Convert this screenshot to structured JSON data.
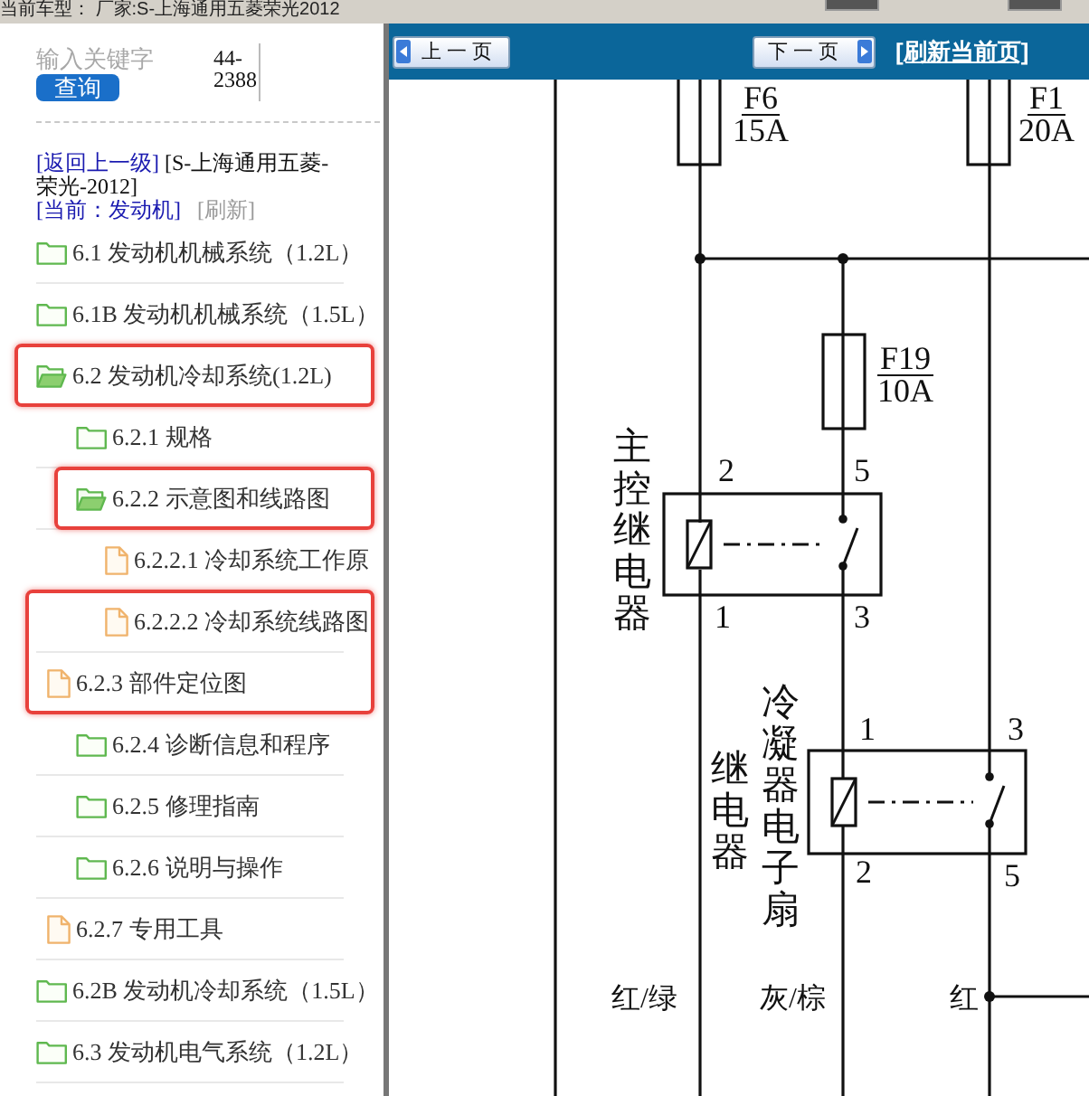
{
  "top_bar": {
    "text": "当前车型： 厂家:S-上海通用五菱荣光2012"
  },
  "sidebar": {
    "search": {
      "placeholder": "输入关键字",
      "side_text": "44-2388",
      "button": "查询"
    },
    "breadcrumb": {
      "back_link": "[返回上一级]",
      "path": "[S-上海通用五菱-荣光-2012]",
      "current": "[当前：发动机]",
      "refresh": "[刷新]"
    },
    "tree": [
      {
        "kind": "folder",
        "label": "6.1 发动机机械系统（1.2L）",
        "expanded": false,
        "highlighted": false
      },
      {
        "kind": "folder",
        "label": "6.1B 发动机机械系统（1.5L）",
        "expanded": false,
        "highlighted": false
      },
      {
        "kind": "folder",
        "label": "6.2 发动机冷却系统(1.2L)",
        "expanded": true,
        "highlighted": true,
        "children": [
          {
            "kind": "folder",
            "label": "6.2.1 规格",
            "expanded": false,
            "highlighted": false
          },
          {
            "kind": "folder",
            "label": "6.2.2 示意图和线路图",
            "expanded": true,
            "highlighted": true,
            "children": [
              {
                "kind": "file",
                "label": "6.2.2.1 冷却系统工作原",
                "highlighted": false
              },
              {
                "kind": "file",
                "label": "6.2.2.2 冷却系统线路图",
                "highlighted": true
              }
            ]
          },
          {
            "kind": "file",
            "label": "6.2.3 部件定位图",
            "highlighted": true
          },
          {
            "kind": "folder",
            "label": "6.2.4 诊断信息和程序",
            "expanded": false,
            "highlighted": false
          },
          {
            "kind": "folder",
            "label": "6.2.5 修理指南",
            "expanded": false,
            "highlighted": false
          },
          {
            "kind": "folder",
            "label": "6.2.6 说明与操作",
            "expanded": false,
            "highlighted": false
          },
          {
            "kind": "file",
            "label": "6.2.7 专用工具",
            "highlighted": false
          }
        ]
      },
      {
        "kind": "folder",
        "label": "6.2B 发动机冷却系统（1.5L）",
        "expanded": false,
        "highlighted": false
      },
      {
        "kind": "folder",
        "label": "6.3 发动机电气系统（1.2L）",
        "expanded": false,
        "highlighted": false
      }
    ]
  },
  "viewer": {
    "toolbar": {
      "prev_button": "上一页",
      "next_button": "下一页",
      "refresh_link": "[刷新当前页]"
    },
    "diagram": {
      "fuses": [
        {
          "name": "F6",
          "rating": "15A"
        },
        {
          "name": "F1",
          "rating": "20A"
        },
        {
          "name": "F19",
          "rating": "10A"
        }
      ],
      "relays": [
        {
          "label_columns": [
            "主控继电器"
          ],
          "pins": [
            "2",
            "5",
            "1",
            "3"
          ]
        },
        {
          "label_columns": [
            "继电器",
            "冷凝器电子扇"
          ],
          "pins": [
            "1",
            "3",
            "2",
            "5"
          ]
        }
      ],
      "wire_labels": [
        "红/绿",
        "灰/棕",
        "红"
      ]
    }
  }
}
